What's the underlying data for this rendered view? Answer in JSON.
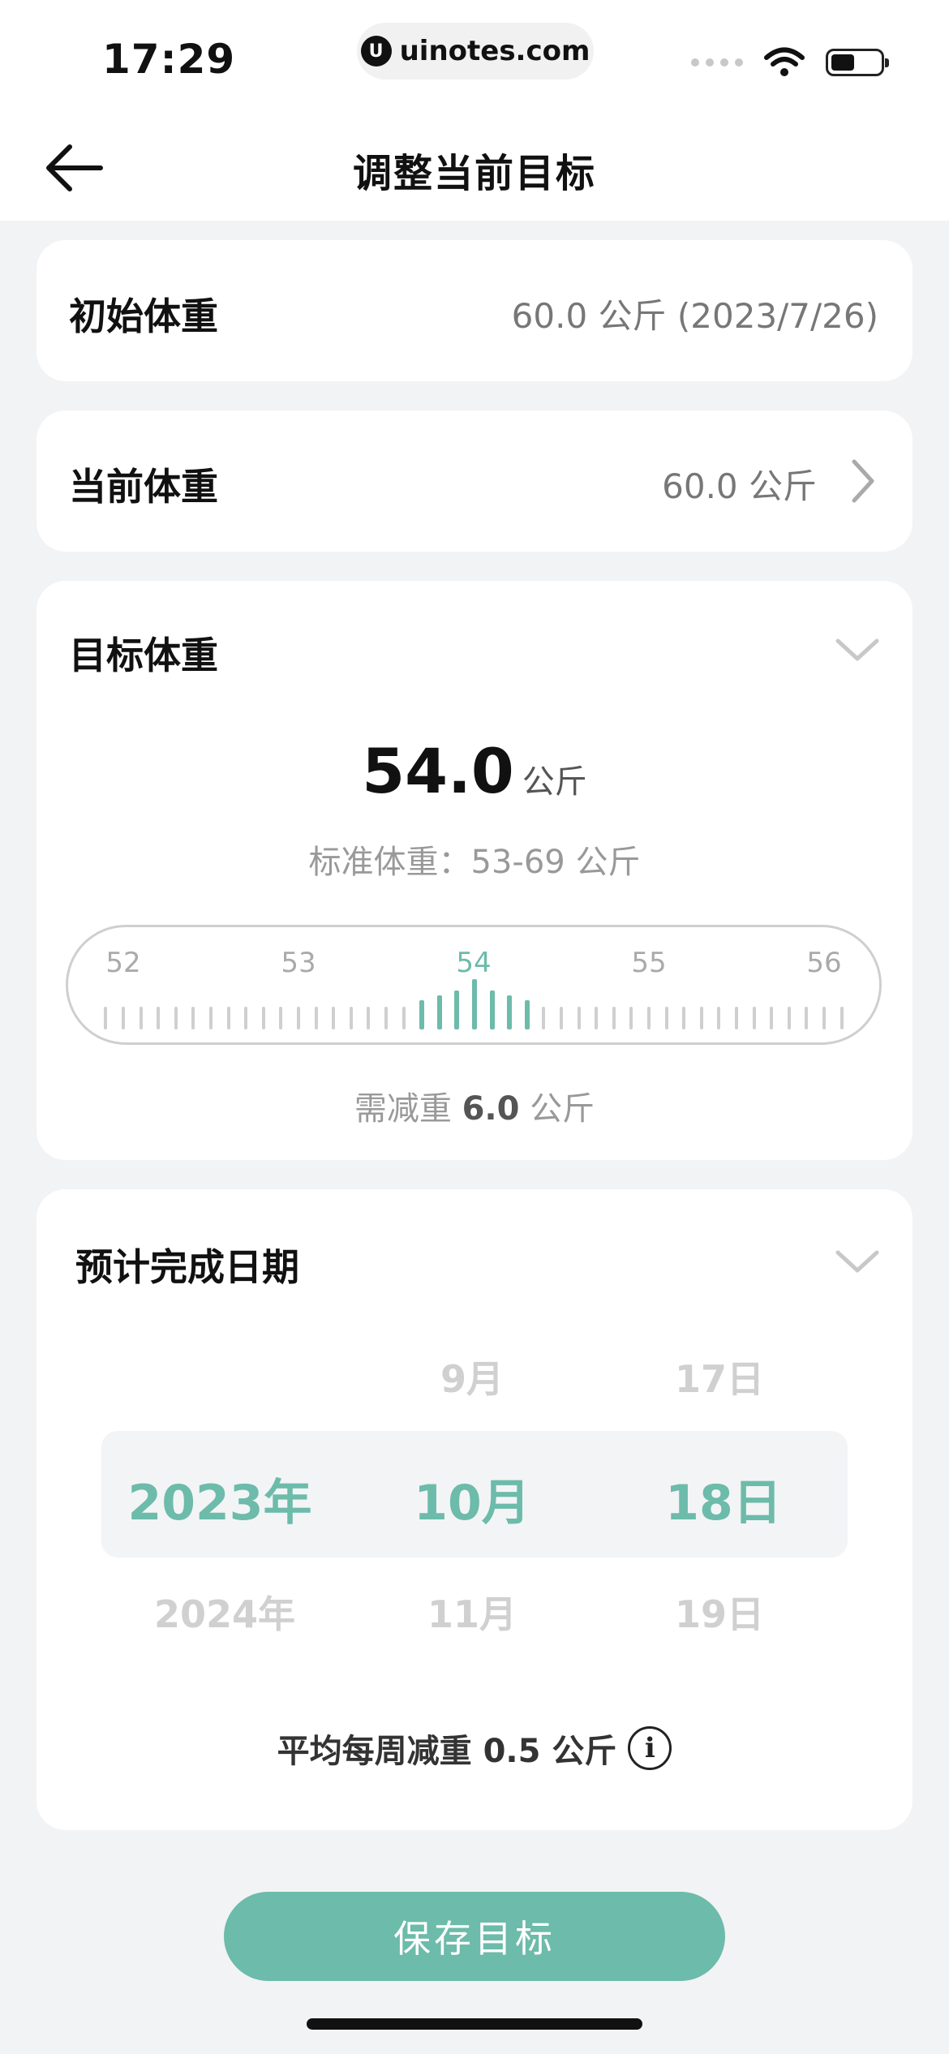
{
  "status_bar": {
    "time": "17:29",
    "url": "uinotes.com"
  },
  "header": {
    "title": "调整当前目标"
  },
  "initial_weight": {
    "label": "初始体重",
    "value": "60.0 公斤 (2023/7/26)"
  },
  "current_weight": {
    "label": "当前体重",
    "value": "60.0 公斤"
  },
  "target_weight": {
    "label": "目标体重",
    "value": "54.0",
    "unit": "公斤",
    "standard_text": "标准体重：53-69 公斤",
    "ruler": {
      "labels": [
        "52",
        "53",
        "54",
        "55",
        "56"
      ],
      "selected": "54"
    },
    "need_prefix": "需减重",
    "need_value": "6.0",
    "need_unit": "公斤"
  },
  "completion_date": {
    "label": "预计完成日期",
    "year": {
      "selected": "2023年",
      "next": "2024年"
    },
    "month": {
      "prev": "9月",
      "selected": "10月",
      "next": "11月"
    },
    "day": {
      "prev": "17日",
      "selected": "18日",
      "next": "19日"
    },
    "avg_text": "平均每周减重 0.5 公斤"
  },
  "save_button": {
    "label": "保存目标"
  },
  "colors": {
    "accent": "#6dbbaa",
    "background": "#f2f3f5"
  },
  "icons": [
    "back-arrow-icon",
    "chevron-right-icon",
    "chevron-down-icon",
    "info-icon",
    "wifi-icon",
    "battery-icon"
  ]
}
